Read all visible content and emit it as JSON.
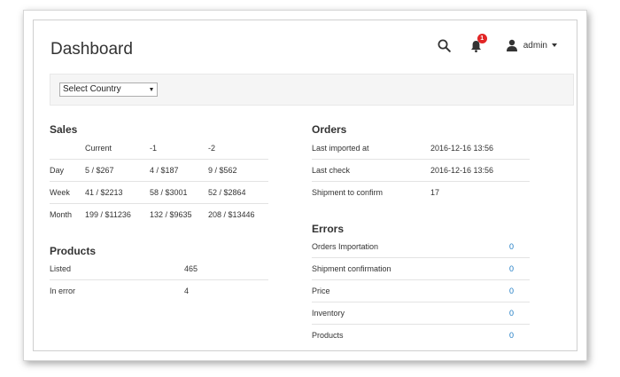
{
  "header": {
    "title": "Dashboard",
    "notification_count": "1",
    "user_name": "admin"
  },
  "filter": {
    "country_select": "Select Country"
  },
  "sales": {
    "title": "Sales",
    "columns": [
      "Current",
      "-1",
      "-2"
    ],
    "rows": [
      {
        "label": "Day",
        "values": [
          "5 / $267",
          "4 / $187",
          "9 / $562"
        ]
      },
      {
        "label": "Week",
        "values": [
          "41 / $2213",
          "58 / $3001",
          "52 / $2864"
        ]
      },
      {
        "label": "Month",
        "values": [
          "199 / $11236",
          "132 / $9635",
          "208 / $13446"
        ]
      }
    ]
  },
  "products": {
    "title": "Products",
    "rows": [
      {
        "label": "Listed",
        "value": "465"
      },
      {
        "label": "In error",
        "value": "4"
      }
    ]
  },
  "orders": {
    "title": "Orders",
    "rows": [
      {
        "label": "Last imported at",
        "value": "2016-12-16 13:56"
      },
      {
        "label": "Last check",
        "value": "2016-12-16 13:56"
      },
      {
        "label": "Shipment to confirm",
        "value": "17"
      }
    ]
  },
  "errors": {
    "title": "Errors",
    "rows": [
      {
        "label": "Orders Importation",
        "value": "0"
      },
      {
        "label": "Shipment confirmation",
        "value": "0"
      },
      {
        "label": "Price",
        "value": "0"
      },
      {
        "label": "Inventory",
        "value": "0"
      },
      {
        "label": "Products",
        "value": "0"
      }
    ]
  },
  "colors": {
    "link": "#1979c3",
    "badge": "#e22626"
  }
}
